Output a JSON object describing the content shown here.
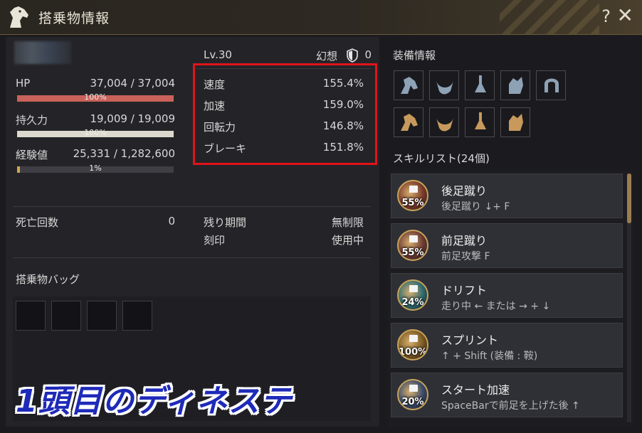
{
  "window": {
    "title": "搭乗物情報",
    "help_label": "?",
    "close_label": "✕"
  },
  "mount": {
    "level": "Lv.30",
    "illusion_label": "幻想",
    "illusion_value": "0"
  },
  "stats": {
    "hp": {
      "label": "HP",
      "value": "37,004 / 37,004",
      "pct": "100%",
      "fraction": 1.0,
      "color": "#c9625a"
    },
    "stamina": {
      "label": "持久力",
      "value": "19,009 / 19,009",
      "pct": "100%",
      "fraction": 1.0,
      "color": "#dcd8cd"
    },
    "exp": {
      "label": "経験値",
      "value": "25,331 / 1,282,600",
      "pct": "1%",
      "fraction": 0.02,
      "color": "#d2a64a"
    }
  },
  "performance": [
    {
      "label": "速度",
      "value": "155.4%"
    },
    {
      "label": "加速",
      "value": "159.0%"
    },
    {
      "label": "回転力",
      "value": "146.8%"
    },
    {
      "label": "ブレーキ",
      "value": "151.8%"
    }
  ],
  "info": {
    "deaths_label": "死亡回数",
    "deaths_value": "0",
    "remaining_label": "残り期間",
    "remaining_value": "無制限",
    "imprint_label": "刻印",
    "imprint_value": "使用中"
  },
  "bag": {
    "title": "搭乗物バッグ"
  },
  "equipment": {
    "title": "装備情報",
    "row1": [
      "horse-helmet-icon",
      "horse-saddle-icon",
      "horse-stirrups-icon",
      "horse-armor-icon",
      "horseshoe-icon"
    ],
    "row2": [
      "horse-helmet-icon",
      "horse-saddle-icon",
      "horse-stirrups-icon",
      "horse-armor-icon"
    ]
  },
  "skills": {
    "title": "スキルリスト(24個)",
    "items": [
      {
        "name": "後足蹴り",
        "key": "後足蹴り ↓+ F",
        "pct": "55%",
        "color": "#7a3a2a"
      },
      {
        "name": "前足蹴り",
        "key": "前足攻撃 F",
        "pct": "55%",
        "color": "#6c3a34"
      },
      {
        "name": "ドリフト",
        "key": "走り中 ← または → + ↓",
        "pct": "24%",
        "color": "#2e6a70"
      },
      {
        "name": "スプリント",
        "key": "↑ + Shift (装備 : 鞍)",
        "pct": "100%",
        "color": "#7a5a22"
      },
      {
        "name": "スタート加速",
        "key": "SpaceBarで前足を上げた後 ↑",
        "pct": "20%",
        "color": "#3a4a6a"
      }
    ]
  },
  "caption": "1頭目のディネステ"
}
